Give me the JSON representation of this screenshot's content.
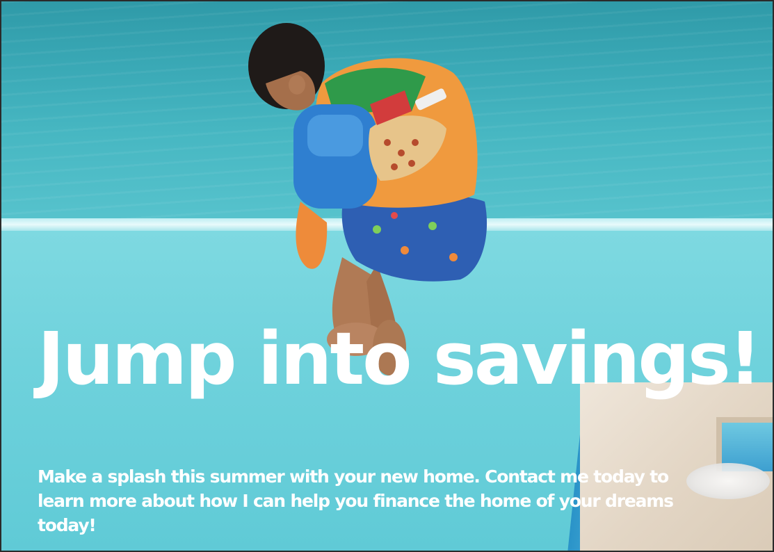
{
  "ad": {
    "headline": "Jump into savings!",
    "body": "Make a splash this summer with your new home. Contact me today to learn more about how I can help you finance the home of your dreams today!"
  },
  "colors": {
    "text": "#ffffff",
    "pool": "#6fd2dc",
    "sea": "#3aa9b6",
    "border": "#2a2a2a"
  },
  "photo": {
    "icon": "child-jumping-into-pool-photo"
  }
}
